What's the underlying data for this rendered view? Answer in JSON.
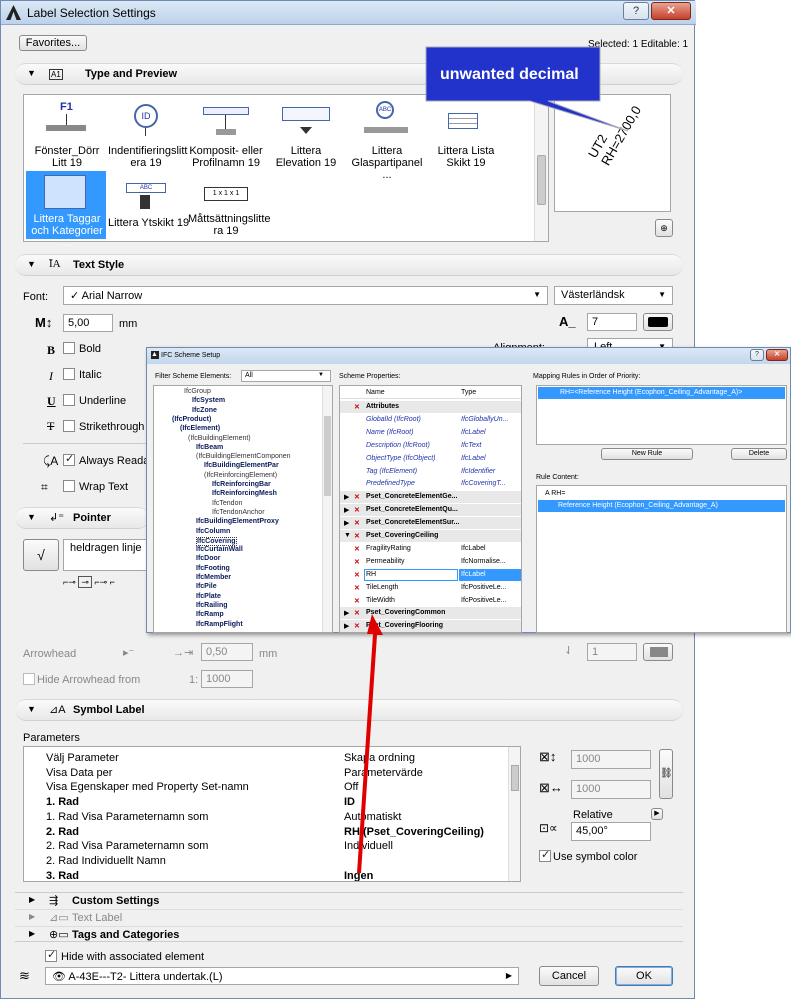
{
  "window": {
    "title": "Label Selection Settings",
    "selected_info": "Selected: 1 Editable: 1",
    "favorites": "Favorites..."
  },
  "sections": {
    "type_preview": "Type and Preview",
    "text_style": "Text Style",
    "pointer": "Pointer",
    "symbol_label": "Symbol Label",
    "custom_settings": "Custom Settings",
    "text_label": "Text Label",
    "tags_categories": "Tags and Categories"
  },
  "labels": [
    {
      "name": "Fönster_Dörr Litt 19"
    },
    {
      "name": "Indentifieringslitt era 19"
    },
    {
      "name": "Komposit- eller Profilnamn 19"
    },
    {
      "name": "Littera Elevation 19"
    },
    {
      "name": "Littera Glaspartipanel ..."
    },
    {
      "name": "Littera Lista Skikt 19"
    },
    {
      "name": "Littera Taggar och Kategorier ..."
    },
    {
      "name": "Littera Ytskikt 19"
    },
    {
      "name": "Måttsättningslitte ra 19"
    }
  ],
  "thumbs": {
    "f1": "F1",
    "id": "ID",
    "abc": "ABC",
    "x111": "1 x 1 x 1"
  },
  "preview": {
    "ut2": "UT2",
    "rh": "RH=2700,0",
    "callout": "unwanted decimal"
  },
  "text_style": {
    "font_label": "Font:",
    "font_value": "✓ Arial Narrow",
    "script_value": "Västerländsk",
    "size_value": "5,00",
    "size_unit": "mm",
    "pen_value": "7",
    "bold": "Bold",
    "italic": "Italic",
    "underline": "Underline",
    "strikethrough": "Strikethrough",
    "always_readable": "Always Readable",
    "wrap_text": "Wrap Text",
    "alignment_label": "Alignment:",
    "alignment_value": "Left"
  },
  "pointer": {
    "line_type": "heldragen linje",
    "arrowhead_label": "Arrowhead",
    "arrow_size": "0,50",
    "arrow_unit": "mm",
    "pen_value": "1",
    "hide_arrowhead": "Hide Arrowhead from",
    "scale_prefix": "1:",
    "scale_value": "1000"
  },
  "symbol": {
    "params_title": "Parameters",
    "rows": [
      {
        "name": "Välj Parameter",
        "value": "Skapa ordning",
        "bold": false
      },
      {
        "name": "Visa Data per",
        "value": "Parametervärde",
        "bold": false
      },
      {
        "name": "Visa Egenskaper med Property Set-namn",
        "value": "Off",
        "bold": false
      },
      {
        "name": "1. Rad",
        "value": "ID",
        "bold": true
      },
      {
        "name": "1. Rad Visa Parameternamn som",
        "value": "Automatiskt",
        "bold": false
      },
      {
        "name": "2. Rad",
        "value": "RH (Pset_CoveringCeiling)",
        "bold": true
      },
      {
        "name": "2. Rad Visa Parameternamn som",
        "value": "Individuell",
        "bold": false
      },
      {
        "name": "2. Rad Individuellt Namn",
        "value": "",
        "bold": false
      },
      {
        "name": "3. Rad",
        "value": "Ingen",
        "bold": true
      }
    ],
    "width_value": "1000",
    "height_value": "1000",
    "relative": "Relative",
    "angle_value": "45,00°",
    "use_symbol_color": "Use symbol color"
  },
  "footer": {
    "hide_with_element": "Hide with associated element",
    "layer": "A-43E---T2- Littera undertak.(L)",
    "cancel": "Cancel",
    "ok": "OK"
  },
  "ifc": {
    "title": "IFC Scheme Setup",
    "filter_label": "Filter Scheme Elements:",
    "filter_value": "All",
    "scheme_props": "Scheme Properties:",
    "col_name": "Name",
    "col_type": "Type",
    "tree": [
      "IfcGroup",
      "IfcSystem",
      "IfcZone",
      "(IfcProduct)",
      "(IfcElement)",
      "(IfcBuildingElement)",
      "IfcBeam",
      "(IfcBuildingElementComponen",
      "IfcBuildingElementPar",
      "(IfcReinforcingElement)",
      "IfcReinforcingBar",
      "IfcReinforcingMesh",
      "IfcTendon",
      "IfcTendonAnchor",
      "IfcBuildingElementProxy",
      "IfcColumn",
      "IfcCovering",
      "IfcCurtainWall",
      "IfcDoor",
      "IfcFooting",
      "IfcMember",
      "IfcPile",
      "IfcPlate",
      "IfcRailing",
      "IfcRamp",
      "IfcRampFlight"
    ],
    "props": [
      {
        "name": "Attributes",
        "type": "",
        "kind": "group"
      },
      {
        "name": "GlobalId (IfcRoot)",
        "type": "IfcGloballyUn...",
        "kind": "attr"
      },
      {
        "name": "Name (IfcRoot)",
        "type": "IfcLabel",
        "kind": "attr"
      },
      {
        "name": "Description (IfcRoot)",
        "type": "IfcText",
        "kind": "attr"
      },
      {
        "name": "ObjectType (IfcObject)",
        "type": "IfcLabel",
        "kind": "attr"
      },
      {
        "name": "Tag (IfcElement)",
        "type": "IfcIdentifier",
        "kind": "attr"
      },
      {
        "name": "PredefinedType",
        "type": "IfcCoveringT...",
        "kind": "attr"
      },
      {
        "name": "Pset_ConcreteElementGe...",
        "type": "",
        "kind": "pset"
      },
      {
        "name": "Pset_ConcreteElementQu...",
        "type": "",
        "kind": "pset"
      },
      {
        "name": "Pset_ConcreteElementSur...",
        "type": "",
        "kind": "pset"
      },
      {
        "name": "Pset_CoveringCeiling",
        "type": "",
        "kind": "pset"
      },
      {
        "name": "FragilityRating",
        "type": "IfcLabel",
        "kind": "prop"
      },
      {
        "name": "Permeability",
        "type": "IfcNormalise...",
        "kind": "prop"
      },
      {
        "name": "RH",
        "type": "IfcLabel",
        "kind": "sel"
      },
      {
        "name": "TileLength",
        "type": "IfcPositiveLe...",
        "kind": "prop"
      },
      {
        "name": "TileWidth",
        "type": "IfcPositiveLe...",
        "kind": "prop"
      },
      {
        "name": "Pset_CoveringCommon",
        "type": "",
        "kind": "pset"
      },
      {
        "name": "Pset_CoveringFlooring",
        "type": "",
        "kind": "pset"
      }
    ],
    "mapping_label": "Mapping Rules in Order of Priority:",
    "mapping_rule": "RH=<Reference Height (Ecophon_Ceiling_Advantage_A)>",
    "new_rule": "New Rule",
    "delete": "Delete",
    "rule_content": "Rule Content:",
    "rc1": "A  RH=",
    "rc2": "Reference Height (Ecophon_Ceiling_Advantage_A)"
  },
  "colors": {
    "accent": "#3399ff",
    "selection": "#cce4f7",
    "callout": "#2233cc",
    "arrow": "#e00000"
  }
}
